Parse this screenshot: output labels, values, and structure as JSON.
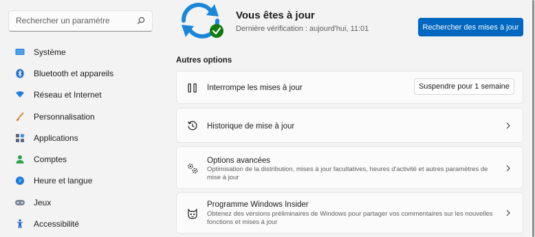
{
  "search": {
    "placeholder": "Rechercher un paramètre"
  },
  "sidebar": {
    "items": [
      {
        "label": "Système",
        "icon": "monitor-icon"
      },
      {
        "label": "Bluetooth et appareils",
        "icon": "bluetooth-icon"
      },
      {
        "label": "Réseau et Internet",
        "icon": "wifi-icon"
      },
      {
        "label": "Personnalisation",
        "icon": "brush-icon"
      },
      {
        "label": "Applications",
        "icon": "apps-icon"
      },
      {
        "label": "Comptes",
        "icon": "person-icon"
      },
      {
        "label": "Heure et langue",
        "icon": "globe-clock-icon"
      },
      {
        "label": "Jeux",
        "icon": "gamepad-icon"
      },
      {
        "label": "Accessibilité",
        "icon": "accessibility-icon"
      }
    ]
  },
  "status": {
    "title": "Vous êtes à jour",
    "subtitle": "Dernière vérification : aujourd'hui, 11:01",
    "check_button": "Rechercher des mises à jour"
  },
  "section": {
    "label": "Autres options"
  },
  "cards": {
    "pause": {
      "title": "Interrompe les mises à jour",
      "button": "Suspendre pour 1 semaine",
      "icon": "pause-icon"
    },
    "history": {
      "title": "Historique de mise à jour",
      "icon": "history-icon"
    },
    "advanced": {
      "title": "Options avancées",
      "desc": "Optimisation de la distribution, mises à jour facultatives, heures d'activité et autres paramètres de mise à jour",
      "icon": "gears-icon"
    },
    "insider": {
      "title": "Programme Windows Insider",
      "desc": "Obtenez des versions préliminaires de Windows pour partager vos commentaires sur les nouvelles fonctions et mises à jour",
      "icon": "insider-cat-icon"
    }
  },
  "colors": {
    "accent": "#0067c0",
    "success": "#0f7b0f",
    "sync_blue": "#1a86d9"
  }
}
